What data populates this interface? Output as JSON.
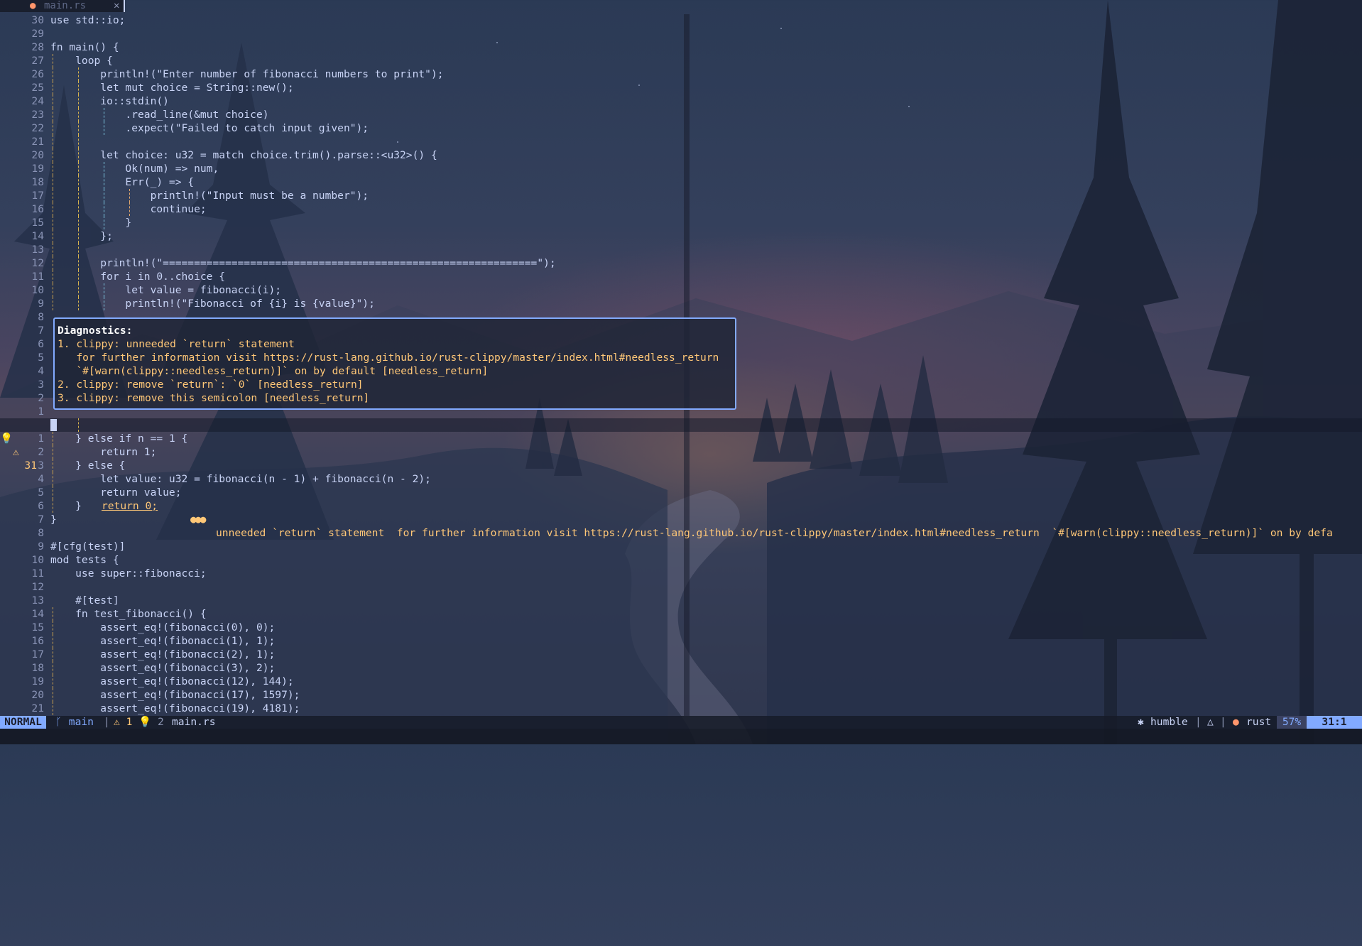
{
  "tab": {
    "icon": "rust-file-icon",
    "name": "main.rs",
    "close": "✕"
  },
  "lines_top": [
    {
      "ln": "30",
      "code": "use std::io;"
    },
    {
      "ln": "29",
      "code": ""
    },
    {
      "ln": "28",
      "code": "fn main() {"
    },
    {
      "ln": "27",
      "code": "    loop {"
    },
    {
      "ln": "26",
      "code": "        println!(\"Enter number of fibonacci numbers to print\");"
    },
    {
      "ln": "25",
      "code": "        let mut choice = String::new();"
    },
    {
      "ln": "24",
      "code": "        io::stdin()"
    },
    {
      "ln": "23",
      "code": "            .read_line(&mut choice)"
    },
    {
      "ln": "22",
      "code": "            .expect(\"Failed to catch input given\");"
    },
    {
      "ln": "21",
      "code": ""
    },
    {
      "ln": "20",
      "code": "        let choice: u32 = match choice.trim().parse::<u32>() {"
    },
    {
      "ln": "19",
      "code": "            Ok(num) => num,"
    },
    {
      "ln": "18",
      "code": "            Err(_) => {"
    },
    {
      "ln": "17",
      "code": "                println!(\"Input must be a number\");"
    },
    {
      "ln": "16",
      "code": "                continue;"
    },
    {
      "ln": "15",
      "code": "            }"
    },
    {
      "ln": "14",
      "code": "        };"
    },
    {
      "ln": "13",
      "code": ""
    },
    {
      "ln": "12",
      "code": "        println!(\"============================================================\");"
    },
    {
      "ln": "11",
      "code": "        for i in 0..choice {"
    },
    {
      "ln": "10",
      "code": "            let value = fibonacci(i);"
    },
    {
      "ln": "9",
      "code": "            println!(\"Fibonacci of {i} is {value}\");"
    },
    {
      "ln": "8",
      "code": ""
    },
    {
      "ln": "7",
      "code": ""
    },
    {
      "ln": "6",
      "code": ""
    },
    {
      "ln": "5",
      "code": ""
    },
    {
      "ln": "4",
      "code": ""
    },
    {
      "ln": "3",
      "code": ""
    },
    {
      "ln": "2",
      "code": ""
    },
    {
      "ln": "1",
      "code": ""
    }
  ],
  "diagnostics": {
    "title": "Diagnostics:",
    "lines": [
      "1. clippy: unneeded `return` statement",
      "   for further information visit https://rust-lang.github.io/rust-clippy/master/index.html#needless_return",
      "   `#[warn(clippy::needless_return)]` on by default [needless_return]",
      "2. clippy: remove `return`: `0` [needless_return]",
      "3. clippy: remove this semicolon [needless_return]"
    ]
  },
  "current_line": {
    "hint_icon": "💡",
    "warn_icon": "⚠",
    "ln": "31",
    "code": "return 0;",
    "dots": "●●●",
    "virtual_text": "unneeded `return` statement  for further information visit https://rust-lang.github.io/rust-clippy/master/index.html#needless_return  `#[warn(clippy::needless_return)]` on by defa"
  },
  "lines_bottom": [
    {
      "ln": "1",
      "code": "    } else if n == 1 {"
    },
    {
      "ln": "2",
      "code": "        return 1;"
    },
    {
      "ln": "3",
      "code": "    } else {"
    },
    {
      "ln": "4",
      "code": "        let value: u32 = fibonacci(n - 1) + fibonacci(n - 2);"
    },
    {
      "ln": "5",
      "code": "        return value;"
    },
    {
      "ln": "6",
      "code": "    }"
    },
    {
      "ln": "7",
      "code": "}"
    },
    {
      "ln": "8",
      "code": ""
    },
    {
      "ln": "9",
      "code": "#[cfg(test)]"
    },
    {
      "ln": "10",
      "code": "mod tests {"
    },
    {
      "ln": "11",
      "code": "    use super::fibonacci;"
    },
    {
      "ln": "12",
      "code": ""
    },
    {
      "ln": "13",
      "code": "    #[test]"
    },
    {
      "ln": "14",
      "code": "    fn test_fibonacci() {"
    },
    {
      "ln": "15",
      "code": "        assert_eq!(fibonacci(0), 0);"
    },
    {
      "ln": "16",
      "code": "        assert_eq!(fibonacci(1), 1);"
    },
    {
      "ln": "17",
      "code": "        assert_eq!(fibonacci(2), 1);"
    },
    {
      "ln": "18",
      "code": "        assert_eq!(fibonacci(3), 2);"
    },
    {
      "ln": "19",
      "code": "        assert_eq!(fibonacci(12), 144);"
    },
    {
      "ln": "20",
      "code": "        assert_eq!(fibonacci(17), 1597);"
    },
    {
      "ln": "21",
      "code": "        assert_eq!(fibonacci(19), 4181);"
    }
  ],
  "statusline": {
    "mode": "NORMAL",
    "branch_icon": "git-branch-icon",
    "branch": " main",
    "sep": "|",
    "warnings": "⚠ 1",
    "hints": "💡 2",
    "file": "main.rs",
    "host_icon": "ros-icon",
    "host": "humble",
    "os_icon": "linux-icon",
    "filetype_icon": "rust-file-icon",
    "filetype": "rust",
    "percent": "57%",
    "position": "31:1"
  },
  "colors": {
    "accent": "#82aaff",
    "keyword": "#c099ff",
    "function": "#82aaff",
    "string": "#c3e88d",
    "number": "#ff966c",
    "warning": "#ffc777"
  }
}
